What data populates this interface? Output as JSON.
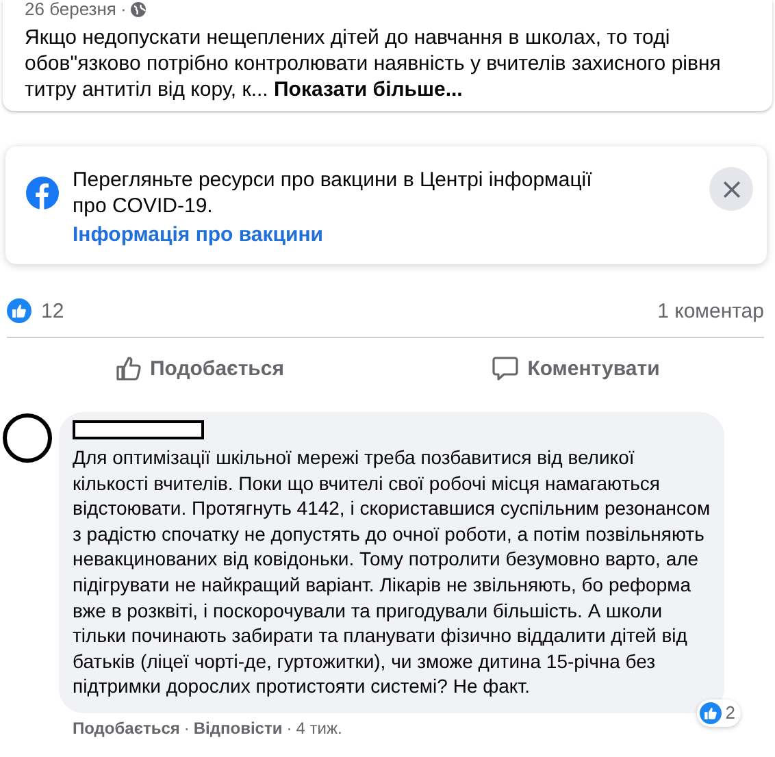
{
  "post": {
    "date": "26 березня",
    "separator": "·",
    "text": "Якщо недопускати нещеплених дітей до навчання в школах, то тоді обов\"язково потрібно контролювати наявність у вчителів захисного рівня титру антитіл від кору, к...",
    "more": "Показати більше..."
  },
  "vaccine_notice": {
    "text": "Перегляньте ресурси про вакцини в Центрі інформації про COVID-19.",
    "link": "Інформація про вакцини"
  },
  "reactions": {
    "count": "12",
    "comments": "1 коментар"
  },
  "actions": [
    {
      "kind": "like",
      "label": "Подобається"
    },
    {
      "kind": "comment",
      "label": "Коментувати"
    }
  ],
  "comment": {
    "text": "Для оптимізації шкільної мережі треба позбавитися від великої кількості вчителів. Поки що вчителі свої робочі місця намагаються відстоювати. Протягнуть 4142, і скориставшися суспільним резонансом з радістю спочатку не допустять до очної роботи, а потім позвільняють невакцинованих від ковідоньки. Тому потролити безумовно варто, але підігрувати не найкращий варіант. Лікарів не звільняють, бо реформа вже в розквіті, і поскорочували та пригодували більшість. А школи тільки починають забирати та планувати фізично віддалити дітей від батьків (ліцеї чорті-де, гуртожитки), чи зможе дитина 15-річна без підтримки дорослих протистояти системі? Не факт.",
    "reaction_count": "2",
    "footer": [
      {
        "kind": "link",
        "label": "Подобається"
      },
      {
        "kind": "separator",
        "label": "·"
      },
      {
        "kind": "link",
        "label": "Відповісти"
      },
      {
        "kind": "separator",
        "label": "·"
      },
      {
        "kind": "time",
        "label": "4 тиж."
      }
    ]
  }
}
